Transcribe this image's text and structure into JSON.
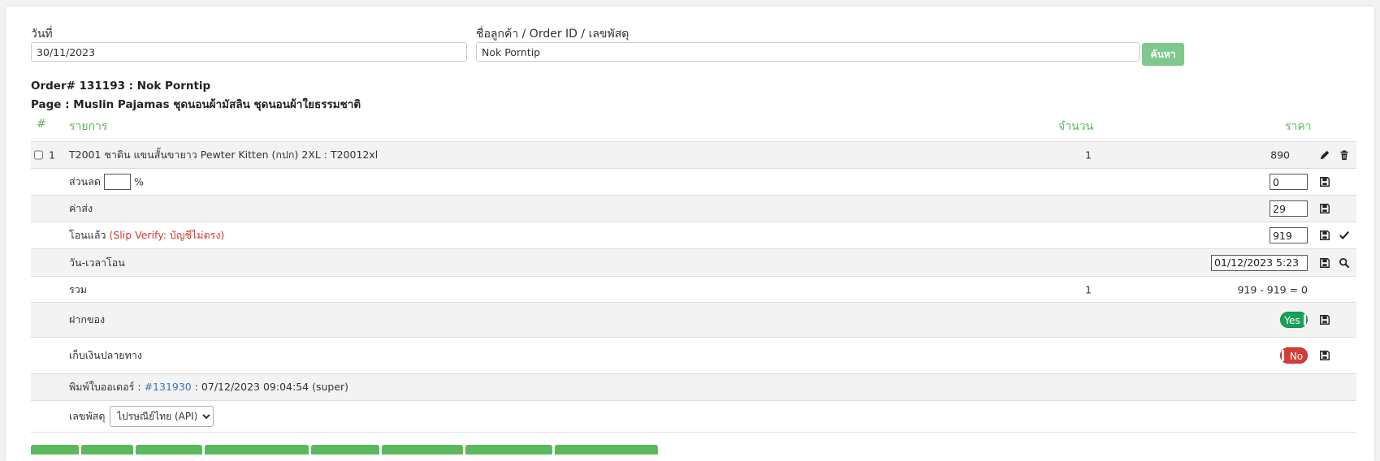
{
  "search": {
    "date_label": "วันที่",
    "date_value": "30/11/2023",
    "customer_label": "ชื่อลูกค้า / Order ID / เลขพัสดุ",
    "customer_value": "Nok Porntip",
    "search_button": "ค้นหา"
  },
  "order": {
    "title": "Order# 131193 : Nok Porntip",
    "page": "Page : Muslin Pajamas ชุดนอนผ้ามัสลิน ชุดนอนผ้าใยธรรมชาติ"
  },
  "table": {
    "headers": {
      "num": "#",
      "item": "รายการ",
      "qty": "จำนวน",
      "price": "ราคา"
    },
    "item": {
      "index": "1",
      "name": "T2001 ชาติน แขนสั้นขายาว Pewter Kitten (กปก) 2XL : T20012xl",
      "qty": "1",
      "price": "890"
    },
    "discount": {
      "label": "ส่วนลด",
      "percent_sign": "%",
      "value": "0"
    },
    "shipping": {
      "label": "ค่าส่ง",
      "value": "29"
    },
    "paid": {
      "label": "โอนแล้ว",
      "note": "(Slip Verify: บัญชีไม่ตรง)",
      "value": "919"
    },
    "transfer_time": {
      "label": "วัน-เวลาโอน",
      "value": "01/12/2023 5:23"
    },
    "total": {
      "label": "รวม",
      "qty": "1",
      "summary": "919 - 919 = 0"
    },
    "deposit": {
      "label": "ฝากของ",
      "toggle": "Yes"
    },
    "cod": {
      "label": "เก็บเงินปลายทาง",
      "toggle": "No"
    },
    "print": {
      "label": "พิมพ์ใบออเดอร์ :",
      "link": "#131930",
      "detail": ": 07/12/2023 09:04:54 (super)"
    },
    "tracking": {
      "label": "เลขพัสดุ",
      "selected": "ไปรษณีย์ไทย (API)"
    }
  },
  "colors": {
    "accent_green": "#5cb85c",
    "button_green": "#7cc88d",
    "warning_red": "#d9362b",
    "toggle_yes": "#16a256",
    "toggle_no": "#d43d35",
    "link_blue": "#3a78b5"
  }
}
